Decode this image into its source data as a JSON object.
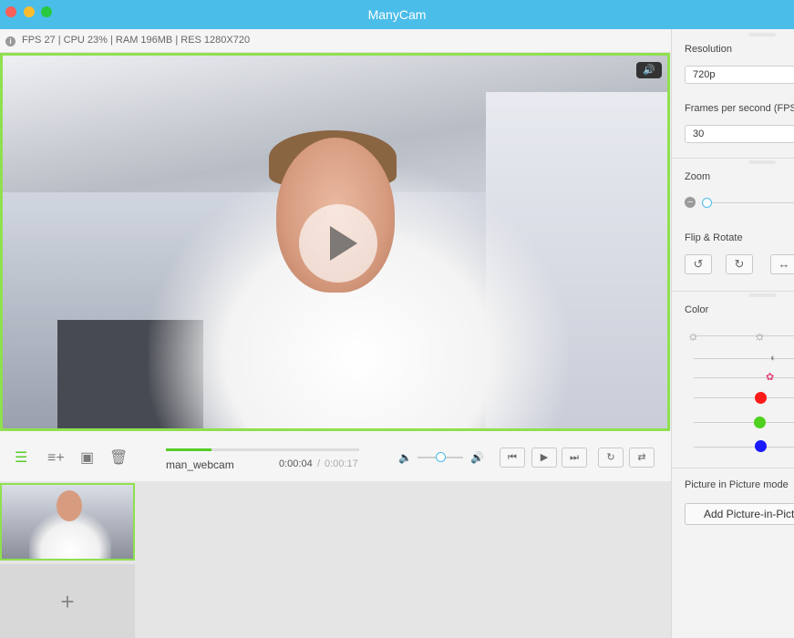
{
  "window": {
    "title": "ManyCam"
  },
  "status": {
    "stats": "FPS 27 | CPU 23% | RAM 196MB | RES 1280X720"
  },
  "player": {
    "media_name": "man_webcam",
    "time_current": "0:00:04",
    "time_separator": "/",
    "time_total": "0:00:17",
    "progress_fraction": 0.235,
    "volume_fraction": 0.5
  },
  "gallery": {
    "add_symbol": "+"
  },
  "sidebar": {
    "resolution_label": "Resolution",
    "resolution_value": "720p",
    "fps_label": "Frames per second (FPS)",
    "fps_value": "30",
    "zoom_label": "Zoom",
    "flip_label": "Flip & Rotate",
    "color_label": "Color",
    "pip_label": "Picture in Picture mode",
    "pip_button": "Add Picture-in-Picture"
  },
  "colors": {
    "accent_green": "#8fe04f",
    "titlebar_blue": "#4bbde9",
    "red": "#ff1a1a",
    "green": "#4fd11f",
    "blue": "#1a1aff"
  },
  "icons": [
    "info-icon",
    "play-icon",
    "volume-icon",
    "playlist-icon",
    "add-to-playlist-icon",
    "save-icon",
    "delete-playlist-icon",
    "volume-low-icon",
    "volume-high-icon",
    "skip-back-icon",
    "play-small-icon",
    "skip-forward-icon",
    "repeat-icon",
    "shuffle-icon",
    "plus-icon",
    "zoom-minus-icon",
    "rotate-left-icon",
    "rotate-right-icon",
    "flip-horizontal-icon",
    "brightness-icon",
    "contrast-icon",
    "saturation-icon"
  ]
}
